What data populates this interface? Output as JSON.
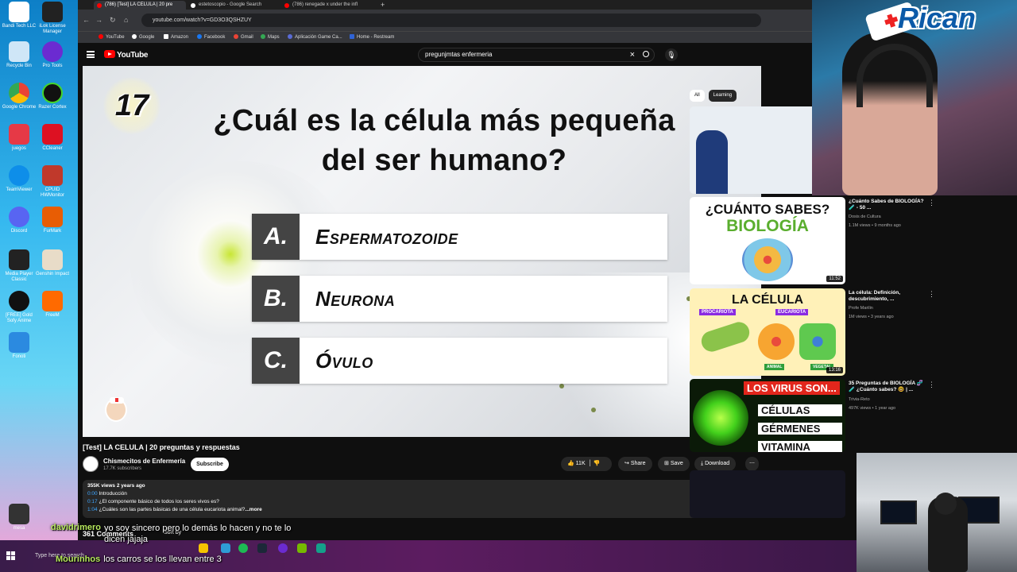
{
  "browser": {
    "tabs": [
      {
        "label": "(786) [Test] LA CELULA | 20 pre"
      },
      {
        "label": "estetoscopio - Google Search"
      },
      {
        "label": "(786) renegade x under the infl"
      }
    ],
    "url": "youtube.com/watch?v=GD3O3QSHZUY",
    "bookmarks": [
      "YouTube",
      "Google",
      "Amazon",
      "Facebook",
      "Gmail",
      "Maps",
      "Aplicación Game Ca...",
      "Home - Restream"
    ]
  },
  "youtube": {
    "logo": "YouTube",
    "search_query": "pregunjmtas enfermeria",
    "video": {
      "number": "17",
      "question": "¿Cuál es la célula más pequeña del ser humano?",
      "options": [
        {
          "letter": "A.",
          "text": "Espermatozoide"
        },
        {
          "letter": "B.",
          "text": "Neurona"
        },
        {
          "letter": "C.",
          "text": "Óvulo"
        }
      ]
    },
    "title": "[Test] LA CELULA | 20 preguntas y respuestas",
    "channel": {
      "name": "Chismecitos de Enfermería",
      "subscribers": "17.7K subscribers"
    },
    "subscribe_label": "Subscribe",
    "actions": {
      "likes": "11K",
      "share": "Share",
      "save": "Save",
      "download": "Download"
    },
    "description": {
      "stats": "355K views  2 years ago",
      "lines": [
        {
          "time": "0:00",
          "text": "Introducción"
        },
        {
          "time": "0:17",
          "text": "¿El componente básico de todos los seres vivos es?"
        },
        {
          "time": "1:04",
          "text": "¿Cuáles son las partes básicas de una célula eucariota animal?"
        }
      ],
      "more": "...more"
    },
    "comments_count": "361 Comments",
    "sort_by": "Sort by",
    "chips": [
      "All",
      "Learning"
    ],
    "related": [
      {
        "title": "¿Cuánto Sabes de BIOLOGÍA? 🧪 - 50 ...",
        "channel": "Dosis de Cultura",
        "meta": "1.1M views • 9 months ago",
        "duration": "11:52",
        "thumb_top": "¿CUÁNTO SABES?",
        "thumb_bottom": "BIOLOGÍA"
      },
      {
        "title": "La célula: Definición, descubrimiento, ...",
        "channel": "Profe Marilin",
        "meta": "1M views • 3 years ago",
        "duration": "13:16",
        "thumb_top": "LA CÉLULA",
        "thumb_left": "PROCARIOTA",
        "thumb_right": "EUCARIOTA",
        "thumb_a": "ANIMAL",
        "thumb_b": "VEGETAL"
      },
      {
        "title": "35 Preguntas de BIOLOGÍA 🧬🧪 ¿Cuánto sabes? 🤓 | ...",
        "channel": "Trivia-Reto",
        "meta": "497K views • 1 year ago",
        "thumb_top": "LOS VIRUS SON...",
        "thumb_opts": [
          "CÉLULAS",
          "GÉRMENES",
          "VITAMINA"
        ]
      }
    ]
  },
  "overlay": {
    "brand": "Rican",
    "chat": [
      {
        "user": "davidrimero",
        "text": "yo soy sincero pero lo demás lo hacen y no te lo dicen jajaja"
      },
      {
        "user": "Mourinhos",
        "text": "los carros se los llevan entre 3"
      }
    ]
  },
  "desktop": {
    "icons": [
      "Bandi Tech LLC",
      "iLok License Manager",
      "Recycle Bin",
      "Pro Tools",
      "Google Chrome",
      "Razer Cortex",
      "juegos",
      "CCleaner",
      "TeamViewer",
      "CPUID HWMonitor",
      "Discord",
      "FurMark",
      "Media Player Classic",
      "Genshin Impact",
      "[FREE] Gold Sofy Anime",
      "FreeM",
      "Fonoti",
      "mesa"
    ]
  },
  "taskbar": {
    "search_placeholder": "Type here to search"
  },
  "colors": {
    "youtube_red": "#ff0000",
    "answer_letter_bg": "#444444",
    "link_blue": "#3ea6ff",
    "chat_user": "#b6e85d"
  }
}
